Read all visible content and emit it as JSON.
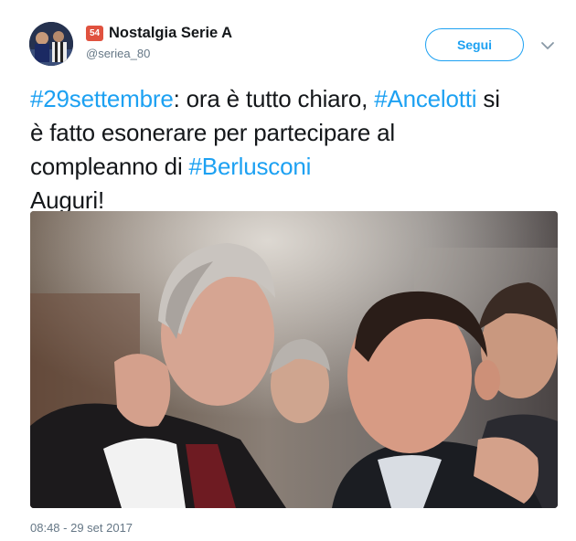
{
  "account": {
    "badge": "54",
    "display_name": "Nostalgia Serie A",
    "handle": "@seriea_80"
  },
  "actions": {
    "follow_label": "Segui",
    "caret_icon": "chevron-down-icon"
  },
  "tweet": {
    "line1": {
      "tag1": "#29settembre",
      "text1": ": ora è tutto chiaro, ",
      "tag2": "#Ancelotti",
      "text2": " si"
    },
    "line2": {
      "text": "è fatto esonerare per partecipare al"
    },
    "line3": {
      "text": "compleanno di ",
      "tag": "#Berlusconi"
    },
    "line4": {
      "text": "Auguri!"
    }
  },
  "timestamp": "08:48 - 29 set 2017",
  "colors": {
    "accent": "#1da1f2",
    "text": "#14171a",
    "muted": "#657786",
    "badge": "#e0523f"
  }
}
